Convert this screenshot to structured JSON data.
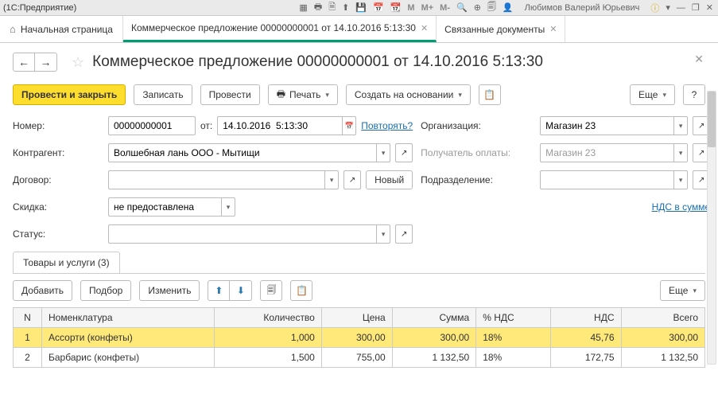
{
  "titlebar": {
    "app_title": "(1С:Предприятие)",
    "user": "Любимов Валерий Юрьевич"
  },
  "tabs": {
    "home": "Начальная страница",
    "items": [
      {
        "label": "Коммерческое предложение 00000000001 от 14.10.2016 5:13:30",
        "active": true
      },
      {
        "label": "Связанные документы",
        "active": false
      }
    ]
  },
  "page": {
    "title": "Коммерческое предложение 00000000001 от 14.10.2016 5:13:30"
  },
  "toolbar": {
    "post_close": "Провести и закрыть",
    "save": "Записать",
    "post": "Провести",
    "print": "Печать",
    "create_based": "Создать на основании",
    "more": "Еще",
    "help": "?"
  },
  "form": {
    "number_label": "Номер:",
    "number_value": "00000000001",
    "from_label": "от:",
    "date_value": "14.10.2016  5:13:30",
    "repeat_link": "Повторять?",
    "org_label": "Организация:",
    "org_value": "Магазин 23",
    "counterparty_label": "Контрагент:",
    "counterparty_value": "Волшебная лань ООО - Мытищи",
    "payee_label": "Получатель оплаты:",
    "payee_value": "Магазин 23",
    "contract_label": "Договор:",
    "contract_value": "",
    "new_btn": "Новый",
    "division_label": "Подразделение:",
    "division_value": "",
    "discount_label": "Скидка:",
    "discount_value": "не предоставлена",
    "vat_link": "НДС в сумме",
    "status_label": "Статус:",
    "status_value": ""
  },
  "subtab": {
    "goods_label": "Товары и услуги (3)"
  },
  "table_toolbar": {
    "add": "Добавить",
    "pick": "Подбор",
    "edit": "Изменить",
    "more": "Еще"
  },
  "table": {
    "headers": {
      "n": "N",
      "nomenclature": "Номенклатура",
      "qty": "Количество",
      "price": "Цена",
      "sum": "Сумма",
      "vat_pct": "% НДС",
      "vat": "НДС",
      "total": "Всего"
    },
    "rows": [
      {
        "n": "1",
        "nomenclature": "Ассорти (конфеты)",
        "qty": "1,000",
        "price": "300,00",
        "sum": "300,00",
        "vat_pct": "18%",
        "vat": "45,76",
        "total": "300,00",
        "selected": true
      },
      {
        "n": "2",
        "nomenclature": "Барбарис (конфеты)",
        "qty": "1,500",
        "price": "755,00",
        "sum": "1 132,50",
        "vat_pct": "18%",
        "vat": "172,75",
        "total": "1 132,50",
        "selected": false
      }
    ]
  }
}
